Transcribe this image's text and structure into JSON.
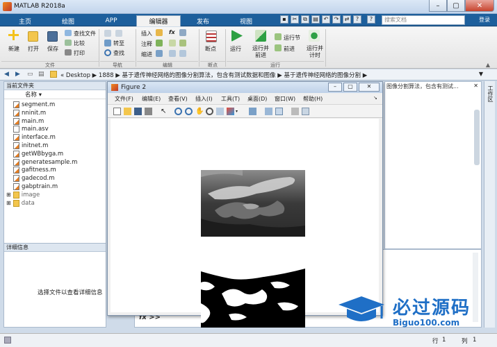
{
  "app": {
    "title": "MATLAB R2018a"
  },
  "tabs": [
    {
      "label": "主页"
    },
    {
      "label": "绘图"
    },
    {
      "label": "APP"
    },
    {
      "label": "编辑器"
    },
    {
      "label": "发布"
    },
    {
      "label": "视图"
    }
  ],
  "search": {
    "placeholder": "搜索文档"
  },
  "login": "登录",
  "ribbon": {
    "file": {
      "new": "新建",
      "open": "打开",
      "save": "保存",
      "find_files": "查找文件",
      "compare": "比较",
      "print": "打印",
      "group": "文件"
    },
    "navigate": {
      "goto": "转至",
      "find": "查找",
      "group": "导航"
    },
    "edit": {
      "insert": "插入",
      "comment": "注释",
      "indent": "缩进",
      "fx": "fx",
      "group": "编辑"
    },
    "breakpoints": {
      "label": "断点",
      "group": "断点"
    },
    "run": {
      "run": "运行",
      "run_advance": "运行并\n前进",
      "run_section": "运行节",
      "advance": "前进",
      "run_time": "运行并\n计时",
      "group": "运行"
    }
  },
  "address": {
    "segments": [
      "«",
      "Desktop",
      "1888",
      "基于遗传神经网络的图像分割算法，包含有测试数据和图像",
      "基于遗传神经网络的图像分割"
    ]
  },
  "current_folder": {
    "title": "当前文件夹",
    "name_header": "名称",
    "files": [
      "segment.m",
      "nninit.m",
      "main.m",
      "main.asv",
      "interface.m",
      "initnet.m",
      "getWBbyga.m",
      "generatesample.m",
      "gafitness.m",
      "gadecod.m",
      "gabptrain.m"
    ],
    "folders": [
      "image",
      "data"
    ]
  },
  "details": {
    "title": "详细信息",
    "hint": "选择文件以查看详细信息"
  },
  "figure": {
    "title": "Figure 2",
    "menus": [
      "文件(F)",
      "编辑(E)",
      "查看(V)",
      "插入(I)",
      "工具(T)",
      "桌面(D)",
      "窗口(W)",
      "帮助(H)"
    ]
  },
  "behind_text": "图像分割算法，包含有测试...",
  "workspace_tab": "工作区",
  "command": {
    "prompt": "fx >>"
  },
  "status": {
    "line_label": "行",
    "line": "1",
    "col_label": "列",
    "col": "1"
  },
  "watermark": {
    "title": "必过源码",
    "url": "Biguo100.com"
  },
  "colors": {
    "accent": "#1d5f9c",
    "ribbon_bg": "#efefef"
  }
}
